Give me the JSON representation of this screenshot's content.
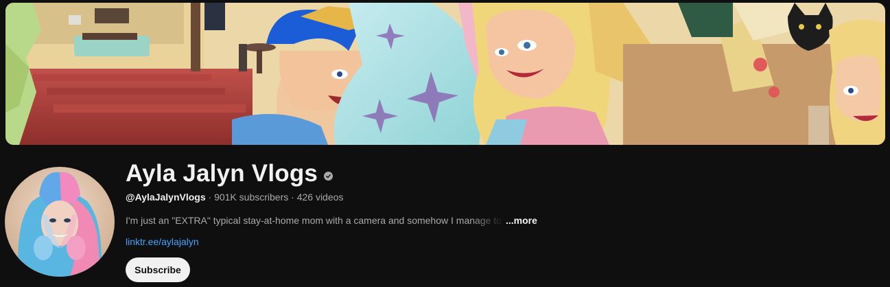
{
  "channel": {
    "name": "Ayla Jalyn Vlogs",
    "verified_icon": "verified-check-icon",
    "handle": "@AylaJalynVlogs",
    "separator": "·",
    "subscribers": "901K subscribers",
    "videos": "426 videos",
    "description": "I'm just an \"EXTRA\" typical stay-at-home mom with a camera and somehow I manage to make it work",
    "more_label": "...more",
    "link_text": "linktr.ee/aylajalyn",
    "subscribe_label": "Subscribe"
  },
  "colors": {
    "background": "#0f0f0f",
    "text_primary": "#f1f1f1",
    "text_secondary": "#aaaaaa",
    "link": "#3ea6ff",
    "button_bg": "#f1f1f1"
  }
}
